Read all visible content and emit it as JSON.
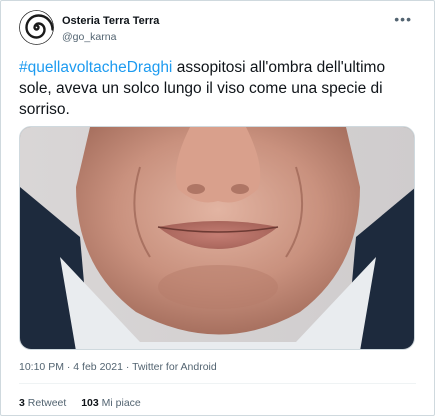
{
  "author": {
    "display_name": "Osteria Terra Terra",
    "handle": "@go_karna"
  },
  "tweet": {
    "hashtag": "#quellavoltacheDraghi",
    "text": " assopitosi all'ombra dell'ultimo sole, aveva un solco lungo il viso come una specie di sorriso.",
    "time": "10:10 PM",
    "separator1": " · ",
    "date": "4 feb 2021",
    "separator2": " · ",
    "source": "Twitter for Android"
  },
  "stats": {
    "retweets_count": "3",
    "retweets_label": "Retweet",
    "likes_count": "103",
    "likes_label": "Mi piace"
  },
  "icons": {
    "more": "more-horizontal-icon",
    "avatar": "spiral-logo"
  },
  "colors": {
    "hashtag": "#1d9bf0",
    "secondary_text": "#536471",
    "border": "#cfd9de"
  }
}
